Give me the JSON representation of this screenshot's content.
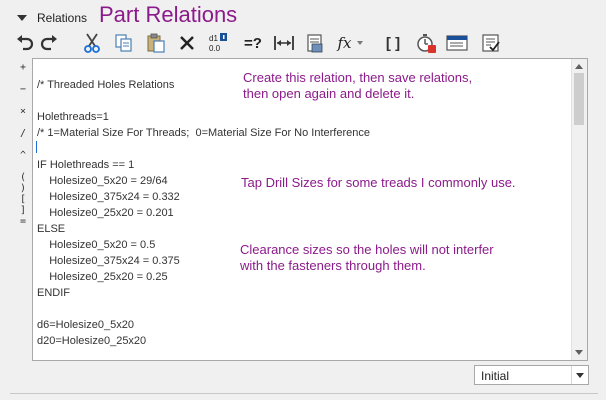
{
  "header": {
    "section_label": "Relations",
    "overlay_title": "Part Relations"
  },
  "toolbar": {
    "icons": [
      "undo-icon",
      "redo-icon",
      "cut-icon",
      "copy-icon",
      "paste-icon",
      "delete-icon",
      "switch-dims-icon",
      "evaluate-icon",
      "measure-icon",
      "verify-icon",
      "function-icon",
      "parentheses-icon",
      "timer-icon",
      "display-icon",
      "sort-icon"
    ],
    "equals_query_label": "=?",
    "function_label": "fx",
    "parentheses_label": "[ ]",
    "dims_top": "d1",
    "dims_bottom": "0.0"
  },
  "operators": [
    "+",
    "−",
    "×",
    "/",
    "^",
    "( )",
    "[ ]",
    "="
  ],
  "editor": {
    "lines": [
      "",
      "/* Threaded Holes Relations",
      "",
      "Holethreads=1",
      "/* 1=Material Size For Threads;  0=Material Size For No Interference",
      "",
      "IF Holethreads == 1",
      "    Holesize0_5x20 = 29/64",
      "    Holesize0_375x24 = 0.332",
      "    Holesize0_25x20 = 0.201",
      "ELSE",
      "    Holesize0_5x20 = 0.5",
      "    Holesize0_375x24 = 0.375",
      "    Holesize0_25x20 = 0.25",
      "ENDIF",
      "",
      "d6=Holesize0_5x20",
      "d20=Holesize0_25x20"
    ],
    "annotations": [
      {
        "line1": "Create this relation, then save relations,",
        "line2": "then open again and delete it."
      },
      {
        "line1": "Tap Drill Sizes for some treads I commonly use.",
        "line2": ""
      },
      {
        "line1": "Clearance sizes so the holes will not interfer",
        "line2": "with the fasteners through them."
      }
    ]
  },
  "footer": {
    "select_value": "Initial"
  },
  "colors": {
    "annotation": "#8b1a8b",
    "accent": "#1a6fd8"
  }
}
